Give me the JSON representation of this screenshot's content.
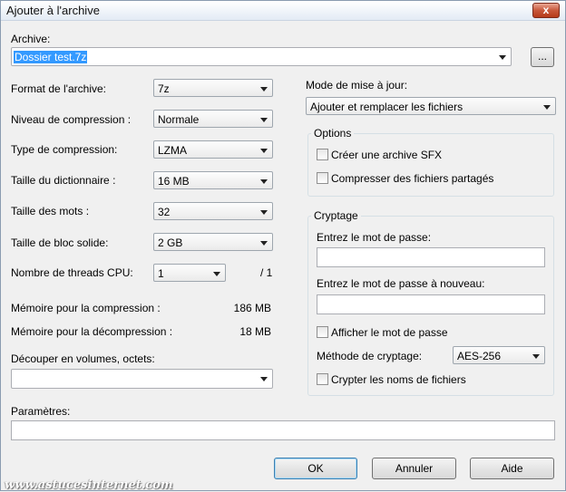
{
  "window": {
    "title": "Ajouter à l'archive",
    "close_glyph": "x"
  },
  "archive": {
    "label": "Archive:",
    "value": "Dossier test.7z",
    "browse_label": "..."
  },
  "left": {
    "format": {
      "label": "Format de l'archive:",
      "value": "7z"
    },
    "level": {
      "label": "Niveau de compression :",
      "value": "Normale"
    },
    "method": {
      "label": "Type de compression:",
      "value": "LZMA"
    },
    "dict": {
      "label": "Taille du dictionnaire :",
      "value": "16 MB"
    },
    "word": {
      "label": "Taille des mots :",
      "value": "32"
    },
    "block": {
      "label": "Taille de bloc solide:",
      "value": "2 GB"
    },
    "threads": {
      "label": "Nombre de threads CPU:",
      "value": "1",
      "max": "/ 1"
    },
    "mem_comp": {
      "label": "Mémoire pour la compression :",
      "value": "186 MB"
    },
    "mem_decomp": {
      "label": "Mémoire pour la décompression :",
      "value": "18 MB"
    },
    "split": {
      "label": "Découper en volumes, octets:",
      "value": ""
    },
    "params": {
      "label": "Paramètres:",
      "value": ""
    }
  },
  "right": {
    "update": {
      "label": "Mode de mise à jour:",
      "value": "Ajouter et remplacer les fichiers"
    },
    "options": {
      "title": "Options",
      "sfx": "Créer une archive SFX",
      "shared": "Compresser des fichiers partagés"
    },
    "encryption": {
      "title": "Cryptage",
      "password_label": "Entrez le mot de passe:",
      "password_repeat_label": "Entrez le mot de passe à nouveau:",
      "show_password": "Afficher le mot de passe",
      "method_label": "Méthode de cryptage:",
      "method_value": "AES-256",
      "encrypt_names": "Crypter les noms de fichiers"
    }
  },
  "buttons": {
    "ok": "OK",
    "cancel": "Annuler",
    "help": "Aide"
  },
  "watermark": "www.astucesinternet.com"
}
